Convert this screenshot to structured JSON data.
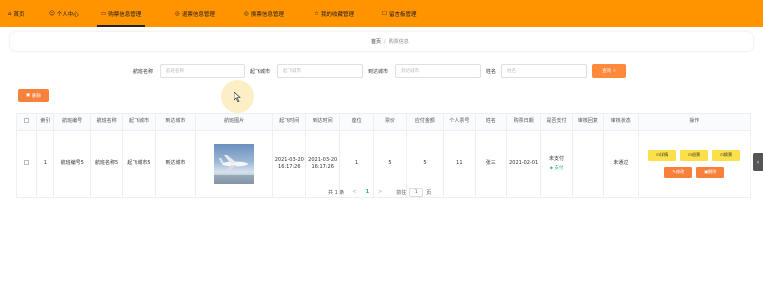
{
  "nav": {
    "items": [
      {
        "label": "首页",
        "icon": "home-icon"
      },
      {
        "label": "个人中心",
        "icon": "user-icon"
      },
      {
        "label": "购票信息管理",
        "icon": "ticket-icon"
      },
      {
        "label": "退票信息管理",
        "icon": "refund-icon"
      },
      {
        "label": "换票信息管理",
        "icon": "exchange-icon"
      },
      {
        "label": "我的收藏管理",
        "icon": "star-icon"
      },
      {
        "label": "留言板管理",
        "icon": "message-icon"
      }
    ],
    "active_index": 2,
    "color": "#ff9300"
  },
  "breadcrumb": {
    "home": "首页",
    "separator": "/",
    "current": "购票信息"
  },
  "search": {
    "flight_name_label": "航班名称",
    "flight_name_placeholder": "航班名称",
    "departure_label": "起飞城市",
    "departure_placeholder": "起飞城市",
    "arrival_label": "到达城市",
    "arrival_placeholder": "到达城市",
    "name_label": "姓名",
    "name_placeholder": "姓名",
    "query_label": "查询"
  },
  "toolbar": {
    "delete_label": "删除"
  },
  "table": {
    "headers": [
      "索引",
      "航班编号",
      "航班名称",
      "起飞城市",
      "到达城市",
      "航班图片",
      "起飞时间",
      "到达时间",
      "座位",
      "票价",
      "应付金额",
      "个人票号",
      "姓名",
      "购票日期",
      "是否支付",
      "审核回复",
      "审核状态",
      "操作"
    ],
    "rows": [
      {
        "index": "1",
        "flight_no": "航班编号5",
        "flight_name": "航班名称5",
        "departure_city": "起飞城市5",
        "arrival_city": "到达城市",
        "depart_time": "2021-03-20 16:17:26",
        "arrive_time": "2021-03-20 16:17:26",
        "seat": "1",
        "price": "5",
        "amount_due": "5",
        "ticket_no": "11",
        "name": "张三",
        "purchase_date": "2021-02-01",
        "paid_status": "未支付",
        "pay_link": "支付",
        "review_reply": "",
        "review_status": "未通过",
        "ops": {
          "detail": "详情",
          "refund": "退票",
          "exchange": "换票",
          "edit": "修改",
          "delete": "删除"
        }
      }
    ]
  },
  "pager": {
    "total": "共 1 条",
    "prev": "<",
    "page": "1",
    "next": ">",
    "goto_label": "前往",
    "goto_value": "1",
    "page_suffix": "页"
  },
  "side_tab": "‹"
}
